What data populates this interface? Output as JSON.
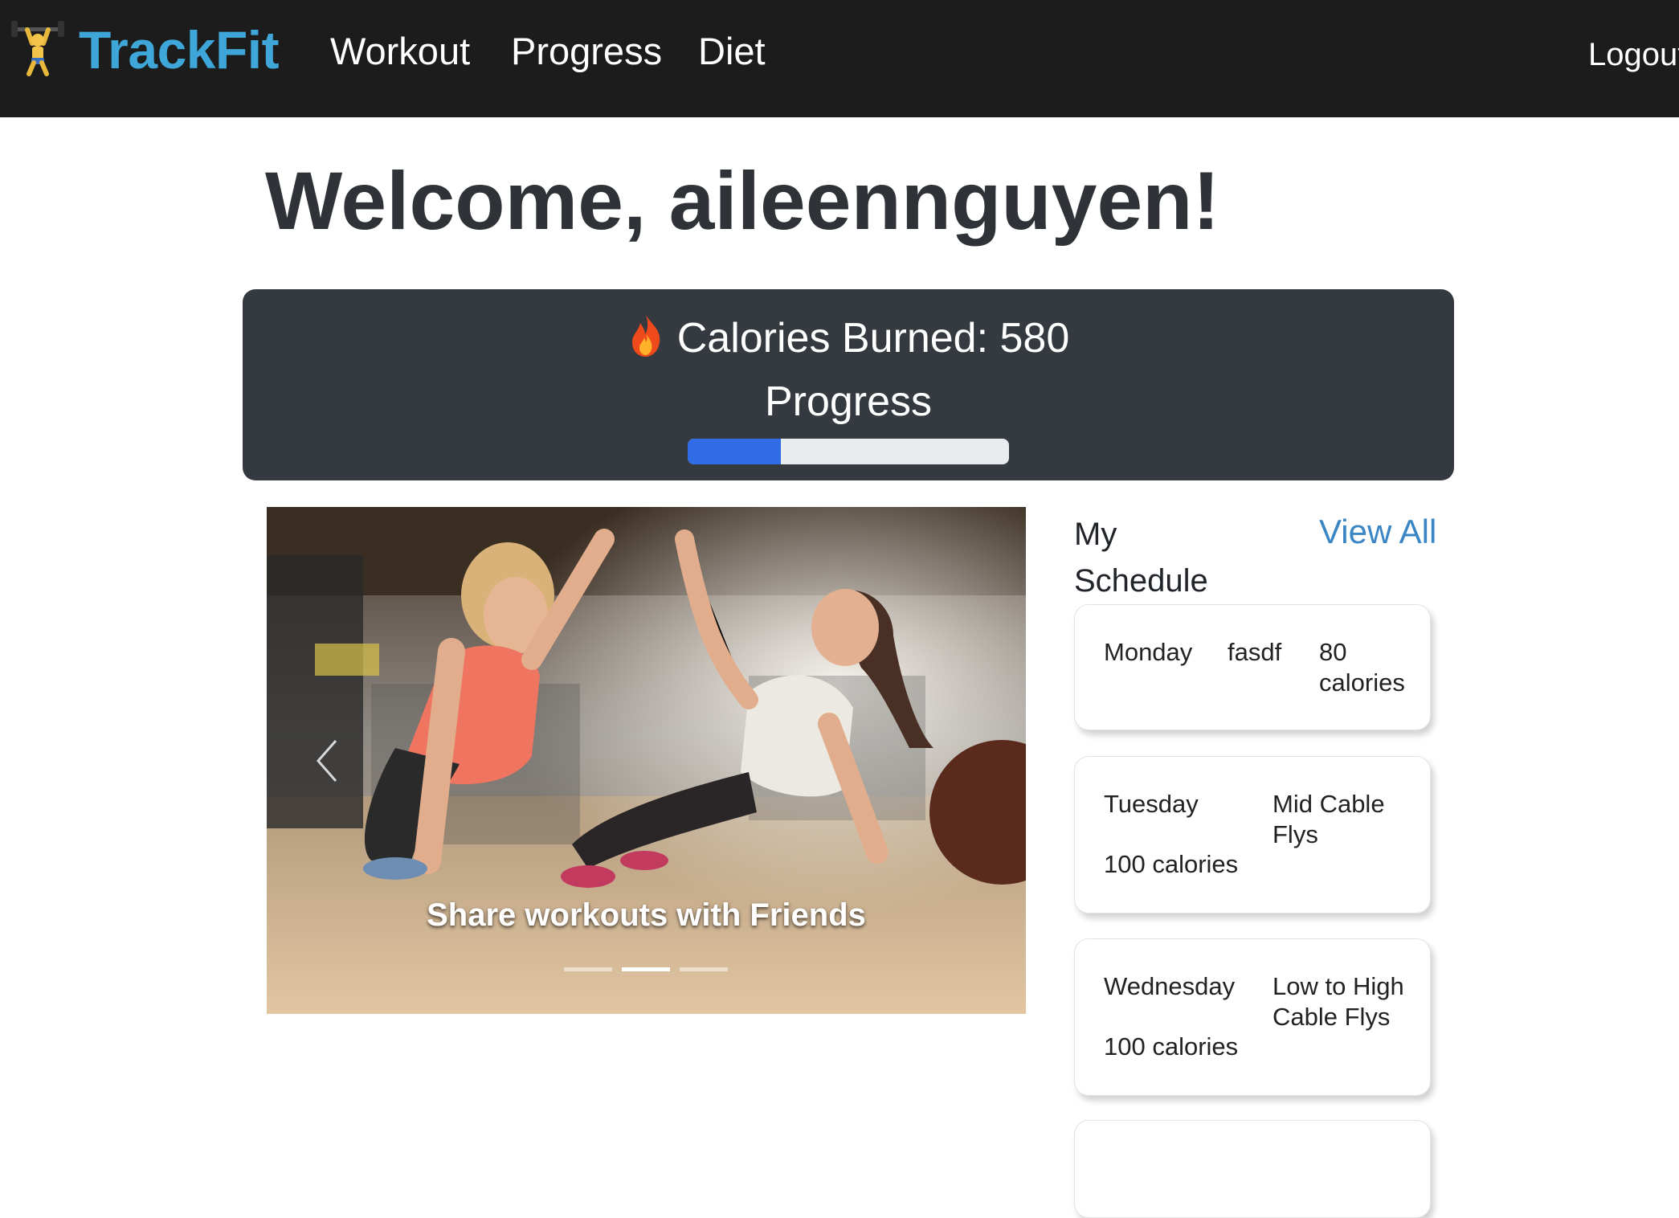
{
  "nav": {
    "brand": "TrackFit",
    "links": [
      "Workout",
      "Progress",
      "Diet"
    ],
    "logout": "Logout"
  },
  "welcome": "Welcome, aileennguyen!",
  "calories": {
    "text": "Calories Burned: 580",
    "progress_label": "Progress",
    "progress_fraction": 0.29
  },
  "carousel": {
    "caption": "Share workouts with Friends",
    "slide_count": 3,
    "active_slide": 1
  },
  "schedule": {
    "title": "My Schedule",
    "view_all": "View All",
    "items": [
      {
        "day": "Monday",
        "workout": "fasdf",
        "calories": "80 calories"
      },
      {
        "day": "Tuesday",
        "workout": "Mid Cable Flys",
        "calories": "100 calories"
      },
      {
        "day": "Wednesday",
        "workout": "Low to High Cable Flys",
        "calories": "100 calories"
      }
    ]
  },
  "colors": {
    "navbar": "#1c1c1c",
    "brand": "#3ea6d8",
    "panel": "#343a40",
    "progress": "#2f6ce5",
    "link": "#3a86c4"
  }
}
